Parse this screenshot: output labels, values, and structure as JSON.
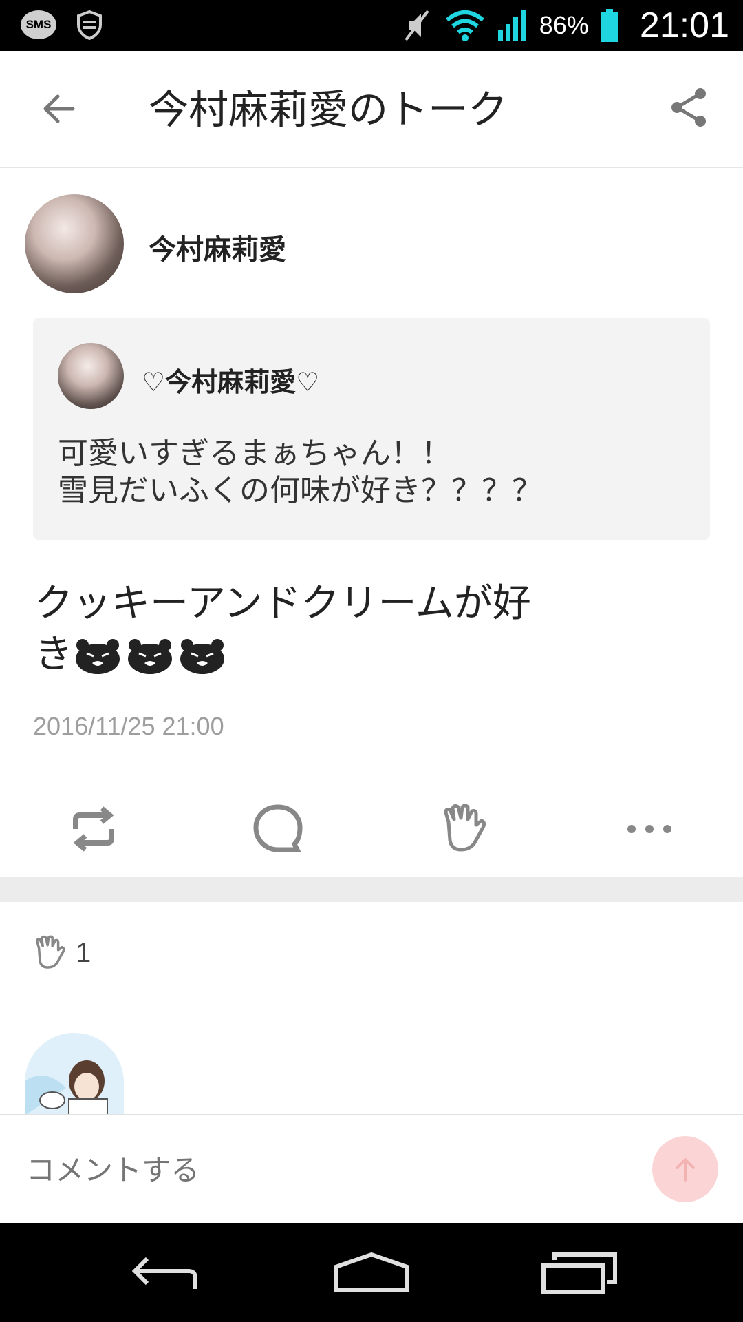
{
  "status_bar": {
    "sms_label": "SMS",
    "battery_percent": "86%",
    "time": "21:01",
    "icons": [
      "sms-icon",
      "shield-icon",
      "mute-icon",
      "wifi-icon",
      "signal-icon",
      "battery-icon"
    ]
  },
  "header": {
    "title": "今村麻莉愛のトーク",
    "back_icon": "back-arrow-icon",
    "share_icon": "share-icon"
  },
  "post": {
    "author_name": "今村麻莉愛",
    "quote": {
      "name": "♡今村麻莉愛♡",
      "lines": [
        "可愛いすぎるまぁちゃん！！",
        "雪見だいふくの何味が好き？？？？"
      ]
    },
    "text_line1": "クッキーアンドクリームが好",
    "text_line2": "き",
    "emoji_icons": [
      "bear-emoji-icon",
      "bear-emoji-icon",
      "bear-emoji-icon"
    ],
    "timestamp": "2016/11/25 21:00",
    "actions": [
      "repost-icon",
      "comment-icon",
      "clap-icon",
      "more-icon"
    ]
  },
  "likes": {
    "count": "1",
    "icon": "clap-icon"
  },
  "comment": {
    "placeholder": "コメントする",
    "send_icon": "send-arrow-icon"
  },
  "nav": [
    "nav-back-icon",
    "nav-home-icon",
    "nav-recents-icon"
  ],
  "colors": {
    "accent_pink": "#fbd5d5",
    "icon_gray": "#888888",
    "separator": "#ececec"
  }
}
